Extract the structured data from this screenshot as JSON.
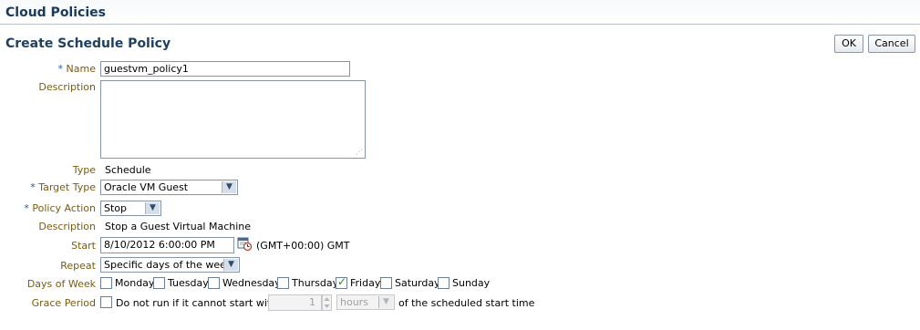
{
  "header": {
    "title": "Cloud Policies"
  },
  "form": {
    "title": "Create Schedule Policy",
    "ok_label": "OK",
    "cancel_label": "Cancel",
    "required_marker": "*",
    "name": {
      "label": "Name",
      "value": "guestvm_policy1"
    },
    "description": {
      "label": "Description",
      "value": ""
    },
    "type": {
      "label": "Type",
      "value": "Schedule"
    },
    "target_type": {
      "label": "Target Type",
      "value": "Oracle VM Guest"
    },
    "policy_action": {
      "label": "Policy Action",
      "value": "Stop"
    },
    "action_description": {
      "label": "Description",
      "value": "Stop a Guest Virtual Machine"
    },
    "start": {
      "label": "Start",
      "value": "8/10/2012 6:00:00 PM",
      "timezone": "(GMT+00:00) GMT"
    },
    "repeat": {
      "label": "Repeat",
      "value": "Specific days of the week"
    },
    "days_of_week": {
      "label": "Days of Week",
      "days": [
        {
          "name": "Monday",
          "checked": false
        },
        {
          "name": "Tuesday",
          "checked": false
        },
        {
          "name": "Wednesday",
          "checked": false
        },
        {
          "name": "Thursday",
          "checked": false
        },
        {
          "name": "Friday",
          "checked": true
        },
        {
          "name": "Saturday",
          "checked": false
        },
        {
          "name": "Sunday",
          "checked": false
        }
      ]
    },
    "grace_period": {
      "label": "Grace Period",
      "checkbox_label": "Do not run if it cannot start within",
      "value": "1",
      "unit": "hours",
      "suffix": "of the scheduled start time"
    }
  },
  "icons": {
    "calendar": "calendar-clock-icon",
    "dropdown": "chevron-down-icon"
  }
}
